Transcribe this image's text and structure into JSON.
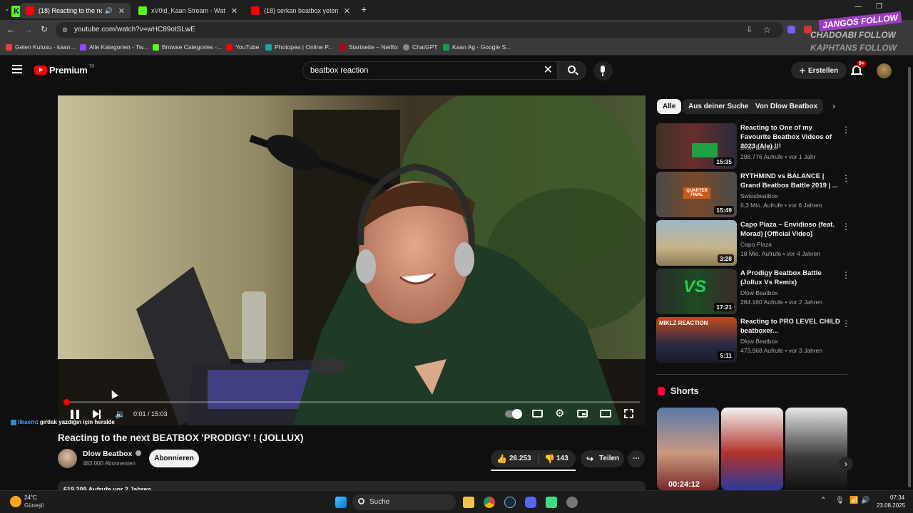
{
  "browser": {
    "tabs": [
      {
        "title": "(18) Reacting to the next BE",
        "active": true
      },
      {
        "title": "xV0id_Kaan Stream - Watch Liv",
        "active": false
      },
      {
        "title": "(18) serkan beatbox yetenek sı",
        "active": false
      }
    ],
    "tab_counter": "4",
    "url": "youtube.com/watch?v=wHC89otSLwE",
    "bookmarks": [
      "Gelen Kutusu - kaan...",
      "Alle Kategorien - Tw...",
      "Browse Categories -...",
      "YouTube",
      "Photopea | Online P...",
      "Startseite – Netflix",
      "ChatGPT",
      "Kaan Ag - Google S..."
    ]
  },
  "overlay": {
    "follow_lines": [
      "JANGOS FOLLOW",
      "CHADOABI FOLLOW",
      "KAPHTANS FOLLOW"
    ],
    "chat_user": "Ilkaern",
    "chat_text": "gırtlak yazdığın için heralde"
  },
  "youtube": {
    "logo_text": "Premium",
    "logo_region": "TR",
    "search_value": "beatbox reaction",
    "create_label": "Erstellen",
    "notif_badge": "9+"
  },
  "player": {
    "time": "0:01 / 15:03",
    "progress_fraction": 0.001
  },
  "video": {
    "title": "Reacting to the next BEATBOX 'PRODIGY' ! (JOLLUX)",
    "channel": "Dlow Beatbox",
    "subscribers": "483.000 Abonnenten",
    "subscribe_label": "Abonnieren",
    "likes": "26.253",
    "dislikes": "143",
    "share_label": "Teilen",
    "views_partial": "619.209 Aufrufe  vor 2 Jahren"
  },
  "chips": [
    "Alle",
    "Aus deiner Suche",
    "Von Dlow Beatbox"
  ],
  "recommendations": [
    {
      "title": "Reacting to One of my Favourite Beatbox Videos of 2023 (Ale) !!!",
      "channel": "Dlow Beatbox",
      "meta": "298.776 Aufrufe • vor 1 Jahr",
      "duration": "15:35"
    },
    {
      "title": "RYTHMIND vs BALANCE | Grand Beatbox Battle 2019 | ...",
      "channel": "Swissbeatbox",
      "meta": "6,3 Mio. Aufrufe • vor 6 Jahren",
      "duration": "15:49"
    },
    {
      "title": "Capo Plaza – Envidioso (feat. Morad) [Official Video]",
      "channel": "Capo Plaza",
      "meta": "18 Mio. Aufrufe • vor 4 Jahren",
      "duration": "3:28"
    },
    {
      "title": "A Prodigy Beatbox Battle (Jollux Vs Remix)",
      "channel": "Dlow Beatbox",
      "meta": "284.160 Aufrufe • vor 2 Jahren",
      "duration": "17:21"
    },
    {
      "title": "Reacting to PRO LEVEL CHILD beatboxer...",
      "channel": "Dlow Beatbox",
      "meta": "473.968 Aufrufe • vor 3 Jahren",
      "duration": "5:11"
    }
  ],
  "thumb_texts": {
    "t2": "QUARTER FINAL",
    "t4": "VS",
    "t5": "MIKLZ REACTION"
  },
  "shorts": {
    "heading": "Shorts",
    "first_duration": "00:24:12"
  },
  "taskbar": {
    "weather_temp": "24°C",
    "weather_desc": "Güneşli",
    "search_label": "Suche",
    "time": "07:34",
    "date": "23.08.2025"
  }
}
